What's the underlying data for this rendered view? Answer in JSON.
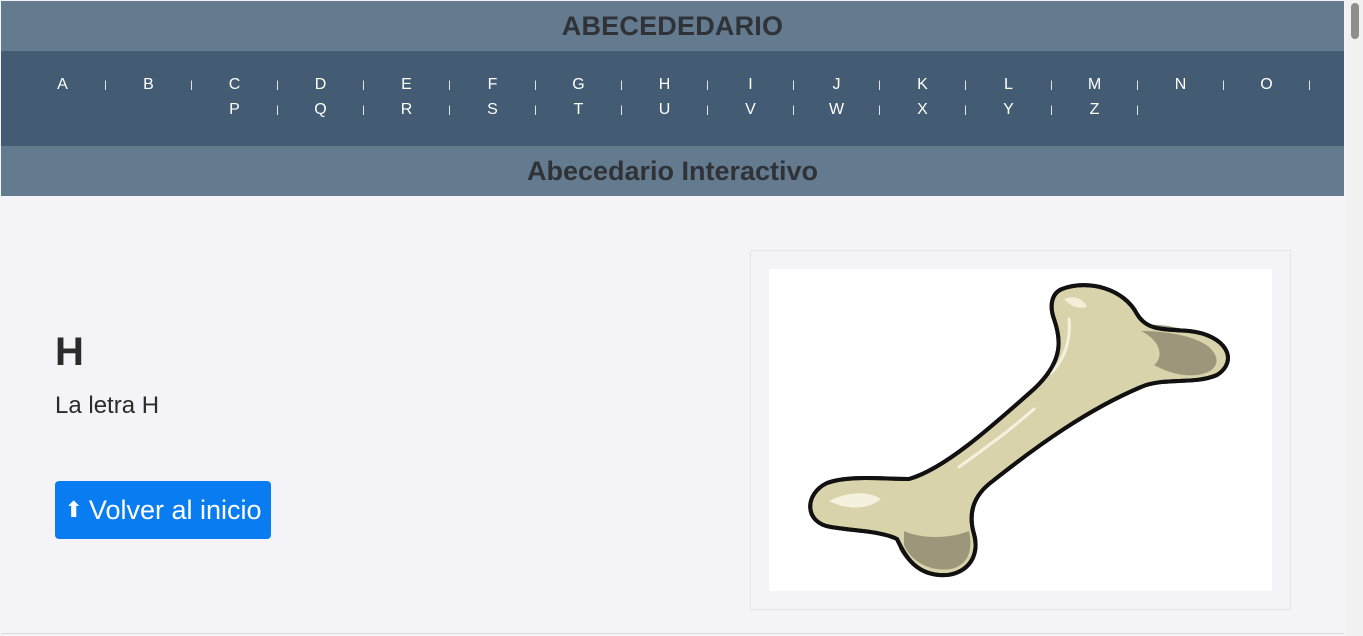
{
  "header": {
    "title": "ABECEDEDARIO"
  },
  "nav": {
    "row1": [
      "A",
      "B",
      "C",
      "D",
      "E",
      "F",
      "G",
      "H",
      "I",
      "J",
      "K",
      "L",
      "M",
      "N",
      "O"
    ],
    "row2": [
      "P",
      "Q",
      "R",
      "S",
      "T",
      "U",
      "V",
      "W",
      "X",
      "Y",
      "Z"
    ],
    "separator": "|"
  },
  "subheader": {
    "title": "Abecedario Interactivo"
  },
  "main": {
    "letter": "H",
    "description": "La letra H",
    "back_button": {
      "icon": "⬆",
      "label": "Volver al inicio"
    },
    "image": {
      "subject": "bone-illustration"
    }
  },
  "colors": {
    "banner": "#647b8f",
    "nav": "#445c73",
    "button": "#0a7cf2",
    "bone_fill": "#d8d3aa",
    "bone_shadow": "#9c977a"
  }
}
